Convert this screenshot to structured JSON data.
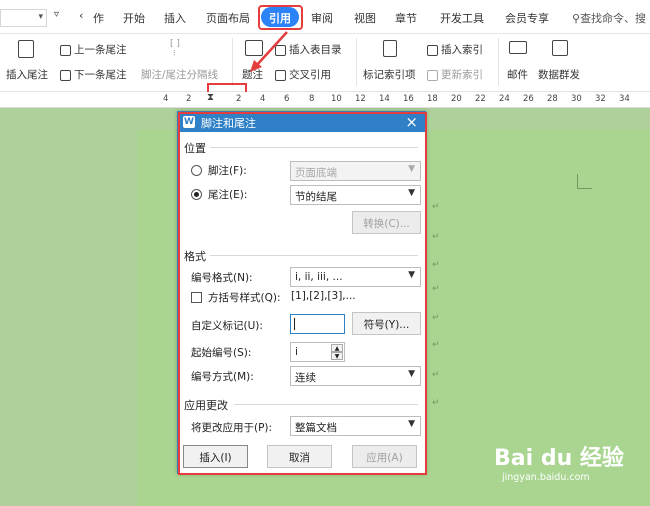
{
  "tabbar": {
    "back_glyph": "‹",
    "tabs": [
      {
        "label": "作"
      },
      {
        "label": "开始"
      },
      {
        "label": "插入"
      },
      {
        "label": "页面布局"
      },
      {
        "label": "引用"
      },
      {
        "label": "审阅"
      },
      {
        "label": "视图"
      },
      {
        "label": "章节"
      },
      {
        "label": "开发工具"
      },
      {
        "label": "会员专享"
      }
    ],
    "search_text": "查找命令、搜"
  },
  "ribbon": {
    "insert_footnote": "插入尾注",
    "prev_endnote": "上一条尾注",
    "next_endnote": "下一条尾注",
    "footnote_separator": "脚注/尾注分隔线",
    "caption": "题注",
    "insert_toc_table": "插入表目录",
    "cross_reference": "交叉引用",
    "mark_index_entry": "标记索引项",
    "insert_index": "插入索引",
    "update_index": "更新索引",
    "mail": "邮件",
    "mass_mail": "数据群发"
  },
  "ruler": {
    "ticks": [
      "4",
      "2",
      "2",
      "4",
      "6",
      "8",
      "10",
      "12",
      "14",
      "16",
      "18",
      "20",
      "22",
      "24",
      "26",
      "28",
      "30",
      "32",
      "34"
    ]
  },
  "dialog": {
    "title": "脚注和尾注",
    "close": "×",
    "app_icon_letter": "W",
    "position": {
      "group_label": "位置",
      "footnote_label": "脚注(F):",
      "footnote_value": "页面底端",
      "endnote_label": "尾注(E):",
      "endnote_value": "节的结尾",
      "convert_button": "转换(C)..."
    },
    "format": {
      "group_label": "格式",
      "number_format_label": "编号格式(N):",
      "number_format_value": "i, ii, iii, ...",
      "bracket_label": "方括号样式(Q):",
      "bracket_sample": "[1],[2],[3],...",
      "custom_mark_label": "自定义标记(U):",
      "custom_mark_value": "",
      "symbol_button": "符号(Y)...",
      "start_at_label": "起始编号(S):",
      "start_at_value": "i",
      "numbering_label": "编号方式(M):",
      "numbering_value": "连续"
    },
    "apply": {
      "group_label": "应用更改",
      "apply_to_label": "将更改应用于(P):",
      "apply_to_value": "整篇文档"
    },
    "buttons": {
      "insert": "插入(I)",
      "cancel": "取消",
      "apply": "应用(A)"
    }
  },
  "watermark": {
    "brand": "Bai du 经验",
    "url": "jingyan.baidu.com"
  },
  "colors": {
    "accent": "#2b83f7",
    "dialog_title": "#2f80c6",
    "highlight_red": "#e53d3d",
    "page_green": "#a9d591"
  }
}
